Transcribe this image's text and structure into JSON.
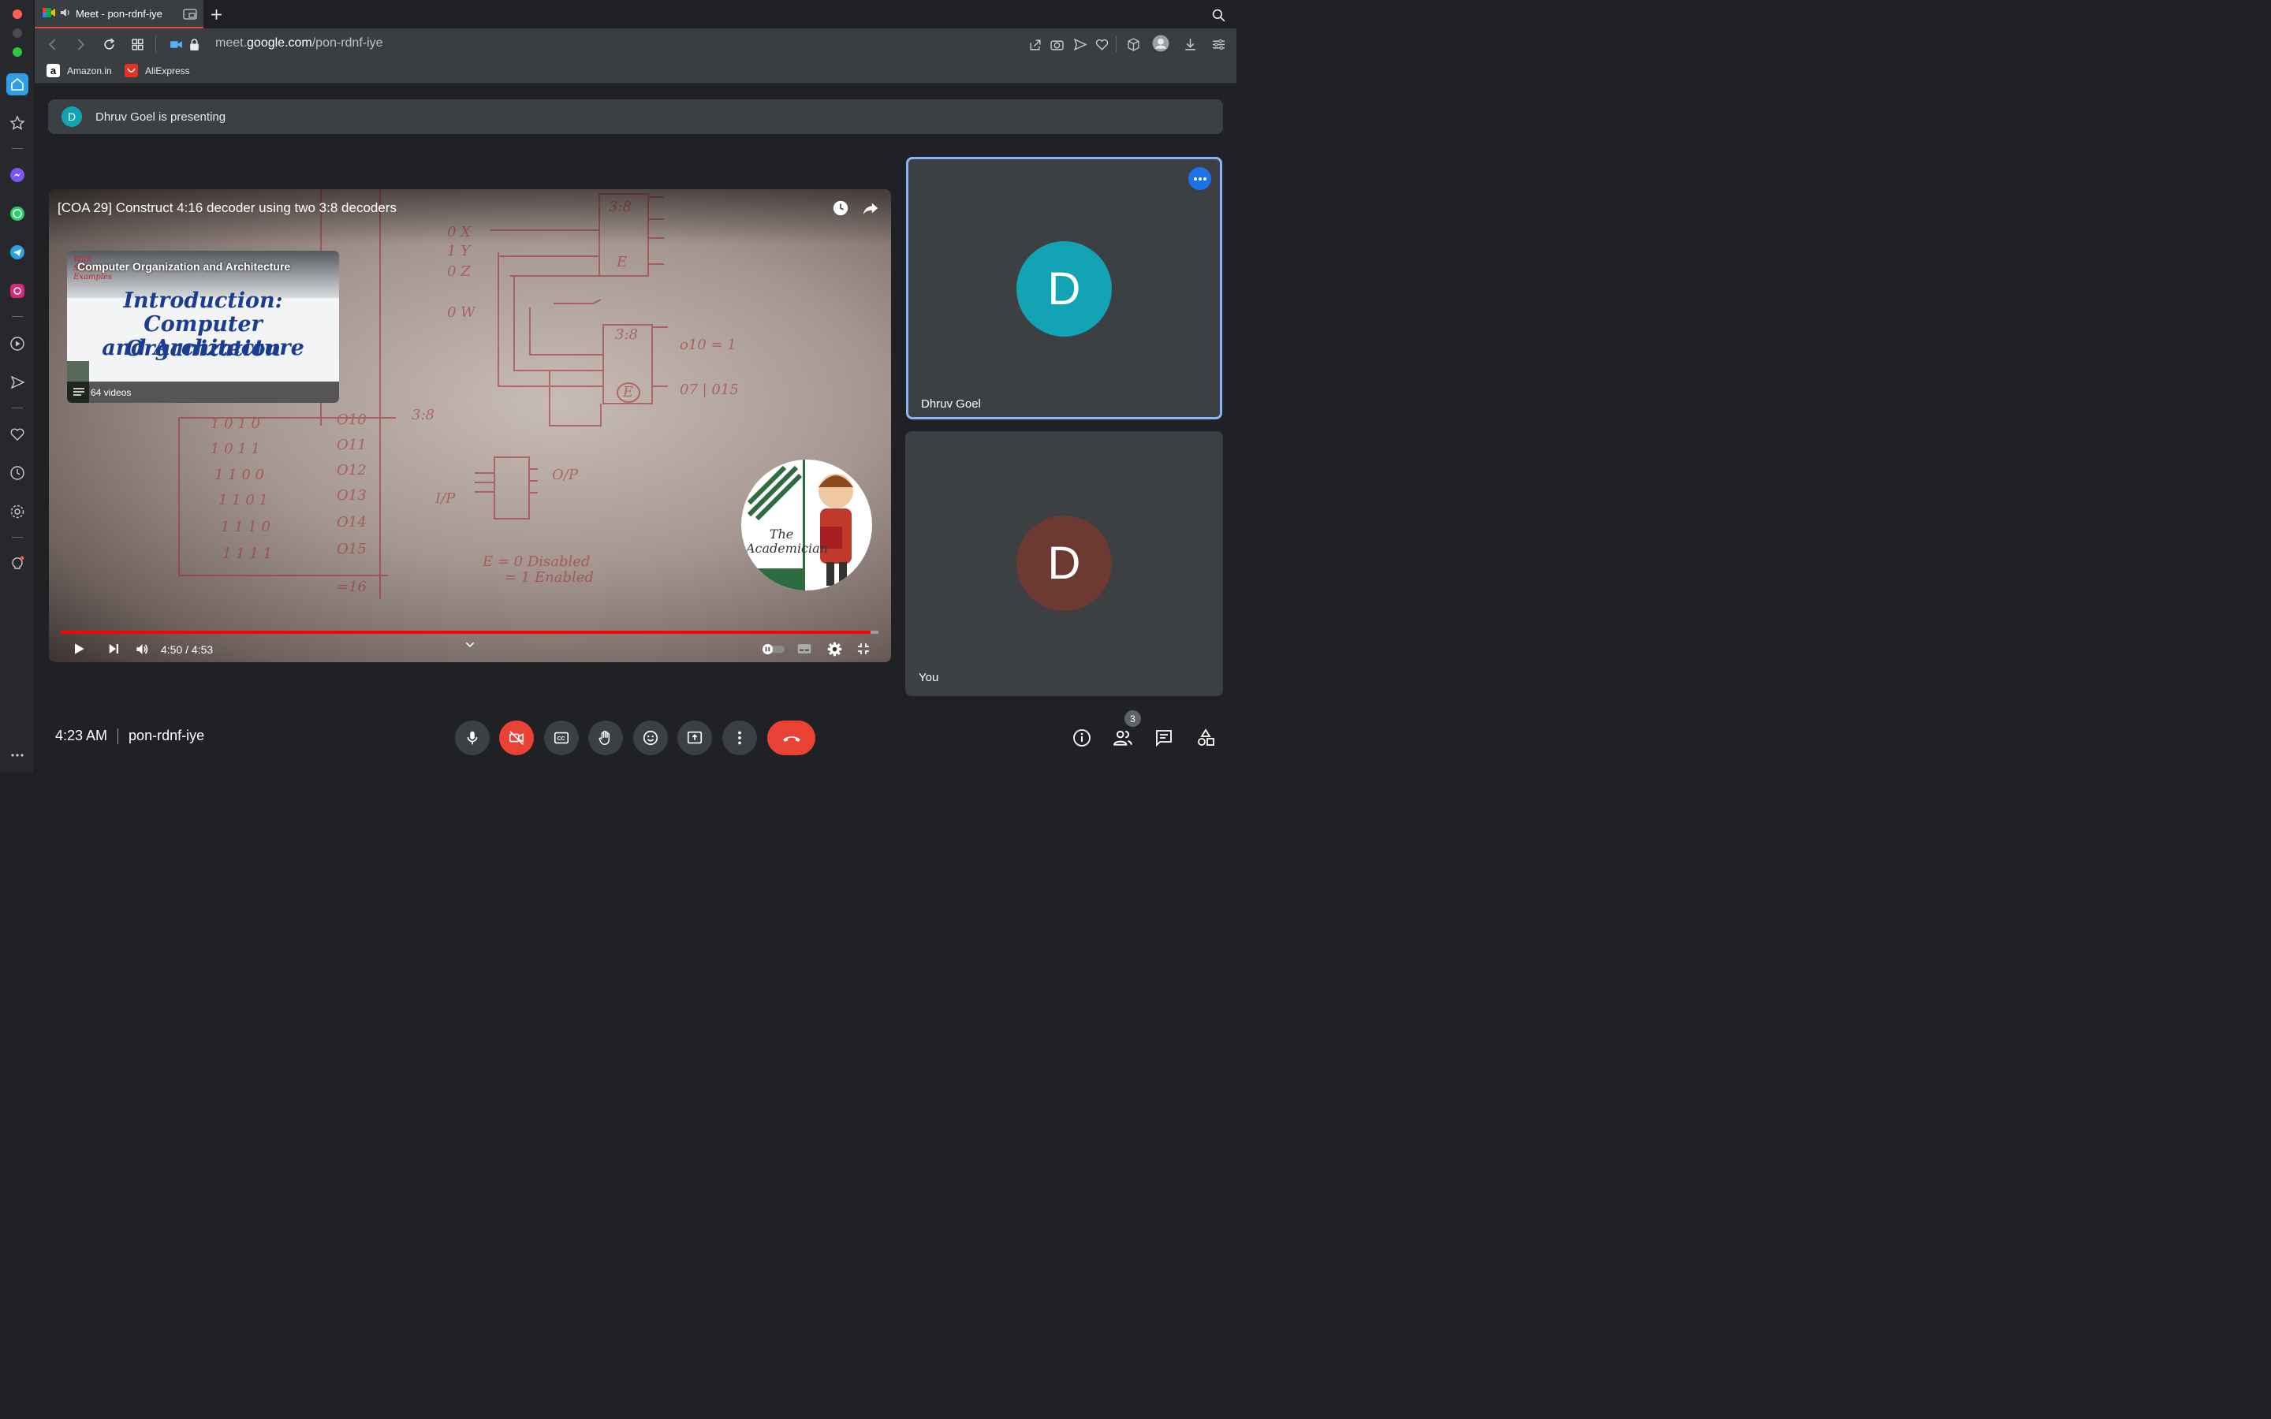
{
  "browser": {
    "tab_title": "Meet - pon-rdnf-iye",
    "url_host_prefix": "meet.",
    "url_host_main": "google.com",
    "url_path": "/pon-rdnf-iye",
    "bookmarks": [
      {
        "label": "Amazon.in",
        "icon": "amazon-icon"
      },
      {
        "label": "AliExpress",
        "icon": "aliexpress-icon"
      }
    ]
  },
  "banner": {
    "avatar_letter": "D",
    "text": "Dhruv Goel is presenting"
  },
  "video": {
    "title": "[COA 29] Construct 4:16 decoder using two 3:8 decoders",
    "playlist_heading": "Computer Organization and Architecture",
    "thumbnail_lines": [
      "Introduction:",
      "Computer Organization",
      "and Architecture"
    ],
    "thumbnail_corner_text": "With Simple Examples",
    "playlist_count": "64 videos",
    "channel_watermark": "The Academician",
    "time": "4:50 / 4:53",
    "progress_fraction": 0.99
  },
  "participants": [
    {
      "name": "Dhruv Goel",
      "letter": "D",
      "color": "#12a4b4",
      "active_speaker": true
    },
    {
      "name": "You",
      "letter": "D",
      "color": "#6d3a32",
      "active_speaker": false
    }
  ],
  "meeting": {
    "clock": "4:23 AM",
    "code": "pon-rdnf-iye",
    "people_count": "3"
  },
  "colors": {
    "accent_blue": "#8ab4f8",
    "end_call_red": "#ea4335",
    "camera_off_red": "#ea4335",
    "background": "#202124"
  }
}
